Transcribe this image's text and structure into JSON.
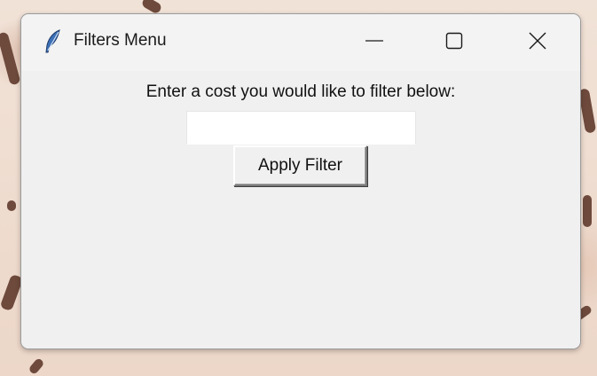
{
  "window": {
    "title": "Filters Menu",
    "app_icon": "feather-icon",
    "controls": {
      "minimize_icon": "minimize-icon",
      "maximize_icon": "maximize-icon",
      "close_icon": "close-icon"
    }
  },
  "filter_form": {
    "prompt": "Enter a cost you would like to filter below:",
    "cost_input": {
      "value": "",
      "placeholder": ""
    },
    "apply_button_label": "Apply Filter"
  },
  "colors": {
    "window_background": "#f0f0f0",
    "titlebar_background": "#f3f3f3",
    "input_background": "#ffffff",
    "feather_icon": "#3b6fb6"
  }
}
